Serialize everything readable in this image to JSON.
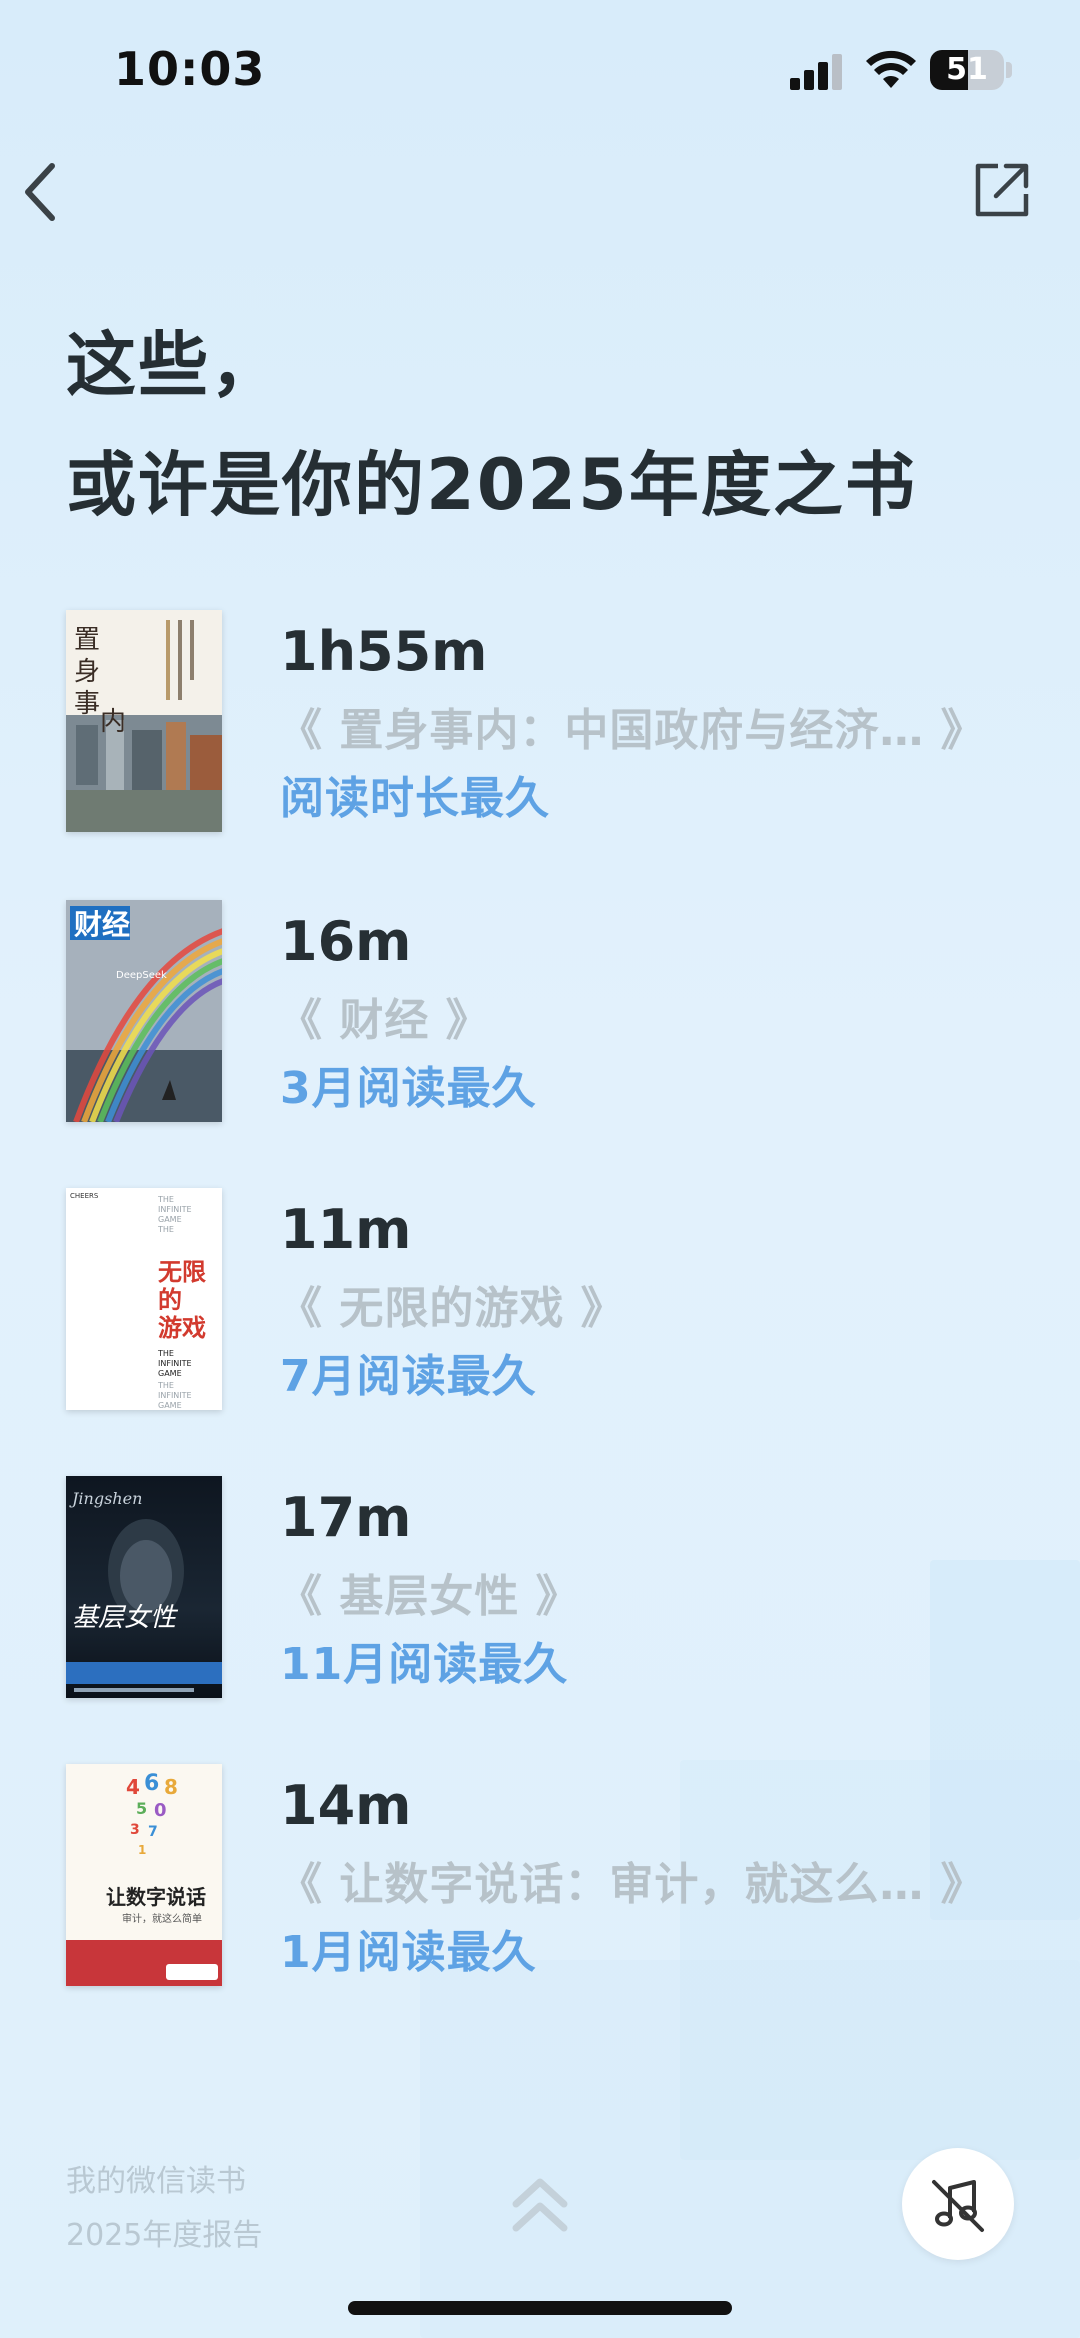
{
  "status_bar": {
    "time": "10:03",
    "battery": "51",
    "battery_level": 0.51
  },
  "nav": {
    "back_icon": "chevron-left-icon",
    "share_icon": "share-external-icon"
  },
  "title": {
    "line1": "这些，",
    "line2": "或许是你的2025年度之书"
  },
  "books": [
    {
      "duration": "1h55m",
      "title": "《 置身事内：中国政府与经济… 》",
      "tag": "阅读时长最久",
      "cover_text": "置身事内"
    },
    {
      "duration": "16m",
      "title": "《 财经 》",
      "tag": "3月阅读最久",
      "cover_text": "财经"
    },
    {
      "duration": "11m",
      "title": "《 无限的游戏 》",
      "tag": "7月阅读最久",
      "cover_text": "无限的游戏"
    },
    {
      "duration": "17m",
      "title": "《 基层女性 》",
      "tag": "11月阅读最久",
      "cover_text": "基层女性"
    },
    {
      "duration": "14m",
      "title": "《 让数字说话：审计，就这么… 》",
      "tag": "1月阅读最久",
      "cover_text": "让数字说话"
    }
  ],
  "footer": {
    "brand_line1": "我的微信读书",
    "brand_line2": "2025年度报告",
    "scroll_icon": "double-chevron-up-icon",
    "music_icon": "music-off-icon"
  },
  "colors": {
    "accent": "#5ea2e4",
    "muted_title": "#b7c2c9",
    "heading": "#252e33"
  }
}
